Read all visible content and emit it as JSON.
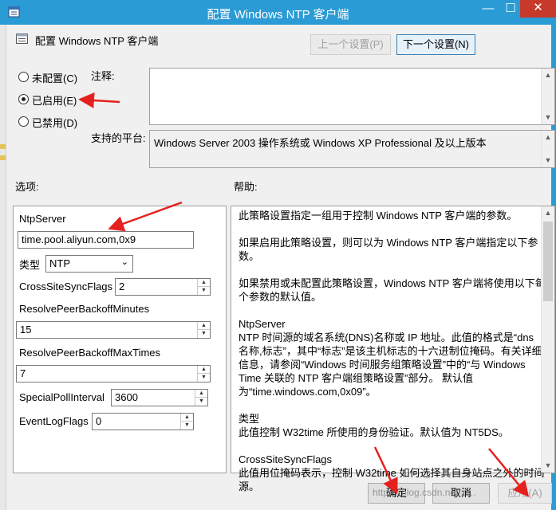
{
  "window": {
    "title": "配置 Windows NTP 客户端",
    "minimize_glyph": "—",
    "maximize_glyph": "☐",
    "close_glyph": "✕"
  },
  "policy": {
    "name": "配置 Windows NTP 客户端",
    "prev_button": "上一个设置(P)",
    "next_button": "下一个设置(N)"
  },
  "state_options": [
    {
      "label": "未配置(C)",
      "checked": false
    },
    {
      "label": "已启用(E)",
      "checked": true
    },
    {
      "label": "已禁用(D)",
      "checked": false
    }
  ],
  "comment": {
    "label": "注释:",
    "value": ""
  },
  "platform": {
    "label": "支持的平台:",
    "value": "Windows Server 2003 操作系统或 Windows XP Professional 及以上版本"
  },
  "options_label": "选项:",
  "help_label": "帮助:",
  "options": {
    "ntpserver_label": "NtpServer",
    "ntpserver_value": "time.pool.aliyun.com,0x9",
    "type_label": "类型",
    "type_value": "NTP",
    "crosssite_label": "CrossSiteSyncFlags",
    "crosssite_value": "2",
    "backoff_minutes_label": "ResolvePeerBackoffMinutes",
    "backoff_minutes_value": "15",
    "backoff_max_label": "ResolvePeerBackoffMaxTimes",
    "backoff_max_value": "7",
    "poll_label": "SpecialPollInterval",
    "poll_value": "3600",
    "eventlog_label": "EventLogFlags",
    "eventlog_value": "0"
  },
  "help": [
    "此策略设置指定一组用于控制 Windows NTP 客户端的参数。",
    "如果启用此策略设置，则可以为 Windows NTP 客户端指定以下参数。",
    "如果禁用或未配置此策略设置，Windows NTP 客户端将使用以下每个参数的默认值。",
    "NtpServer\nNTP 时间源的域名系统(DNS)名称或 IP 地址。此值的格式是“dns 名称,标志”，其中“标志”是该主机标志的十六进制位掩码。有关详细信息，请参阅“Windows 时间服务组策略设置”中的“与 Windows Time 关联的 NTP 客户端组策略设置”部分。 默认值为“time.windows.com,0x09”。",
    "类型\n此值控制 W32time 所使用的身份验证。默认值为 NT5DS。",
    "CrossSiteSyncFlags\n此值用位掩码表示，控制 W32time 如何选择其自身站点之外的时间源。"
  ],
  "buttons": {
    "ok": "确定",
    "cancel": "取消",
    "apply": "应用(A)"
  },
  "watermark": "https://blog.csdn.net/zi...",
  "colors": {
    "titlebar": "#2b9bd6",
    "annotation_arrow": "#e5211f"
  }
}
